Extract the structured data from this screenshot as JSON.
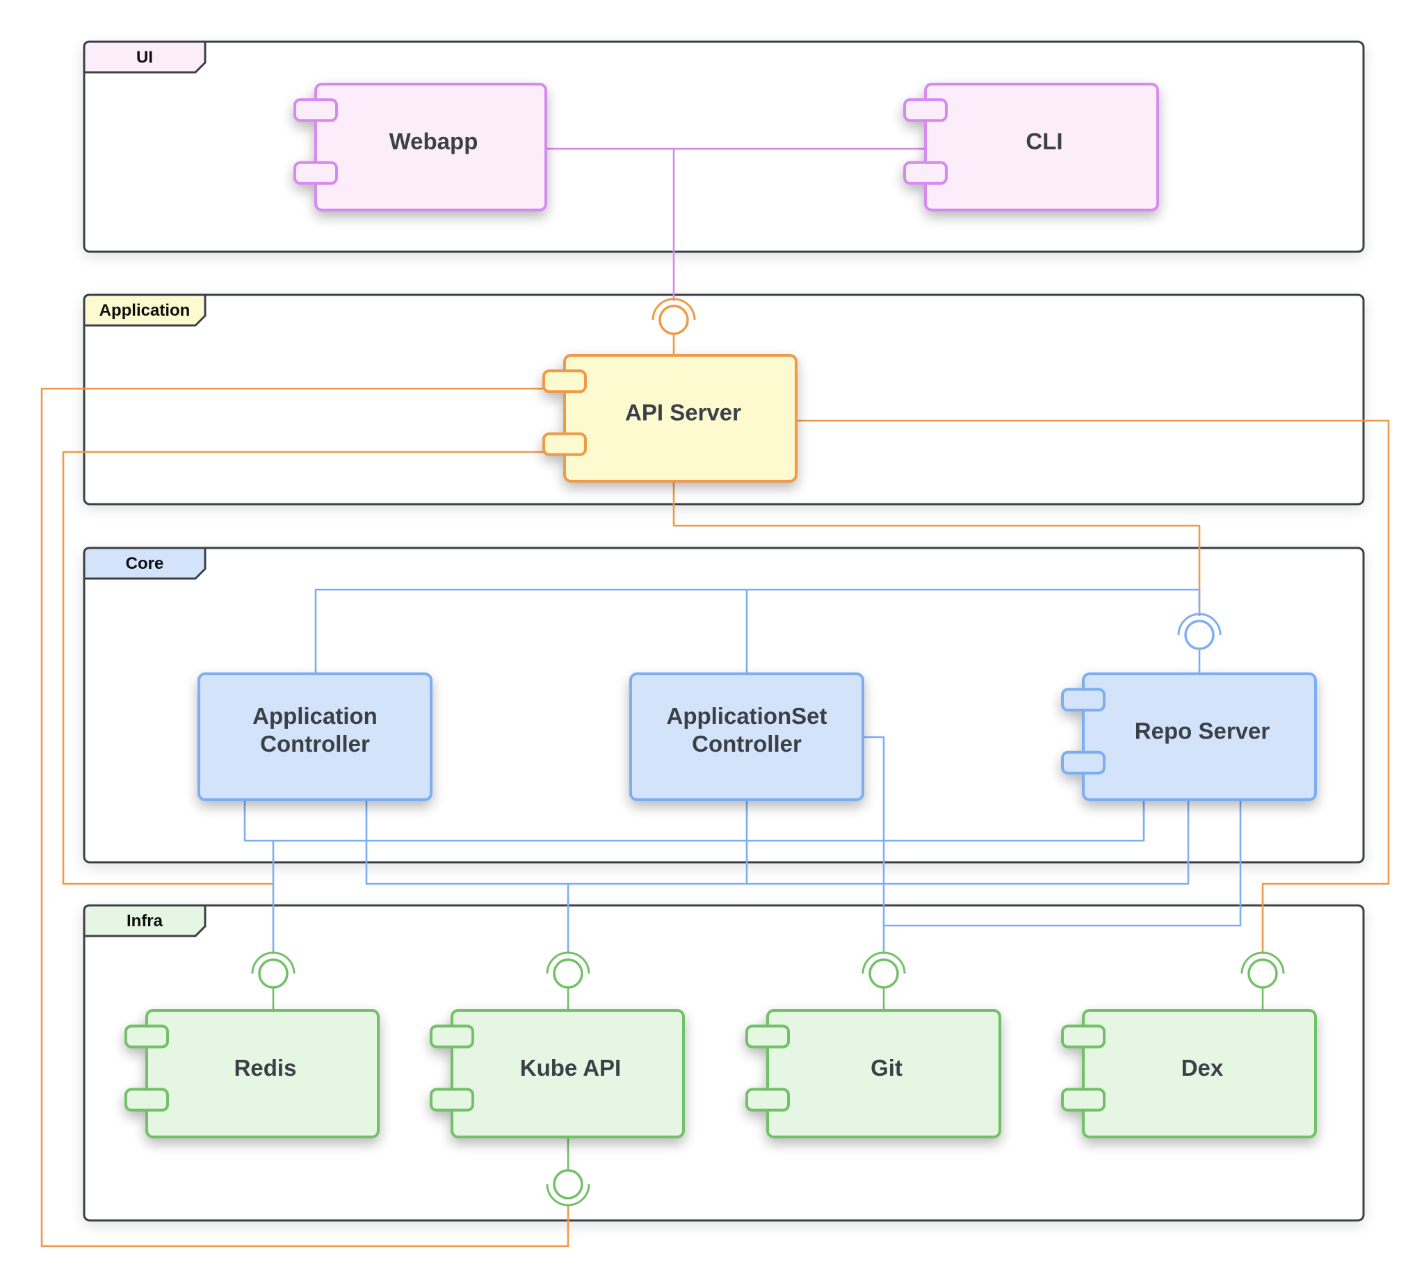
{
  "diagram": {
    "type": "UML component diagram",
    "colors": {
      "ui": {
        "fill": "#fbeefa",
        "stroke": "#d58af0"
      },
      "application": {
        "fill": "#fdfad0",
        "stroke": "#ef9a48"
      },
      "core": {
        "fill": "#d3e3fa",
        "stroke": "#7eaef2"
      },
      "infra": {
        "fill": "#e5f6e2",
        "stroke": "#72c067"
      },
      "frame_stroke": "#3a3f47",
      "text": "#3a3f47"
    },
    "packages": [
      {
        "id": "ui",
        "label": "UI"
      },
      {
        "id": "application",
        "label": "Application"
      },
      {
        "id": "core",
        "label": "Core"
      },
      {
        "id": "infra",
        "label": "Infra"
      }
    ],
    "components": [
      {
        "id": "webapp",
        "package": "ui",
        "label": "Webapp"
      },
      {
        "id": "cli",
        "package": "ui",
        "label": "CLI"
      },
      {
        "id": "api-server",
        "package": "application",
        "label": "API Server"
      },
      {
        "id": "application-controller",
        "package": "core",
        "label_lines": [
          "Application",
          "Controller"
        ]
      },
      {
        "id": "applicationset-controller",
        "package": "core",
        "label_lines": [
          "ApplicationSet",
          "Controller"
        ]
      },
      {
        "id": "repo-server",
        "package": "core",
        "label": "Repo Server"
      },
      {
        "id": "redis",
        "package": "infra",
        "label": "Redis"
      },
      {
        "id": "kube-api",
        "package": "infra",
        "label": "Kube API"
      },
      {
        "id": "git",
        "package": "infra",
        "label": "Git"
      },
      {
        "id": "dex",
        "package": "infra",
        "label": "Dex"
      }
    ],
    "connections": [
      {
        "from": "webapp",
        "to": "api-server",
        "color": "ui"
      },
      {
        "from": "cli",
        "to": "api-server",
        "color": "ui"
      },
      {
        "from": "api-server",
        "to": "kube-api",
        "color": "application"
      },
      {
        "from": "api-server",
        "to": "redis",
        "color": "application"
      },
      {
        "from": "api-server",
        "to": "dex",
        "color": "application"
      },
      {
        "from": "api-server",
        "to": "repo-server",
        "color": "application"
      },
      {
        "from": "application-controller",
        "to": "repo-server",
        "color": "core"
      },
      {
        "from": "applicationset-controller",
        "to": "repo-server",
        "color": "core"
      },
      {
        "from": "application-controller",
        "to": "redis",
        "color": "core"
      },
      {
        "from": "application-controller",
        "to": "kube-api",
        "color": "core"
      },
      {
        "from": "applicationset-controller",
        "to": "kube-api",
        "color": "core"
      },
      {
        "from": "applicationset-controller",
        "to": "git",
        "color": "core"
      },
      {
        "from": "repo-server",
        "to": "redis",
        "color": "core"
      },
      {
        "from": "repo-server",
        "to": "kube-api",
        "color": "core"
      },
      {
        "from": "repo-server",
        "to": "git",
        "color": "core"
      }
    ]
  }
}
